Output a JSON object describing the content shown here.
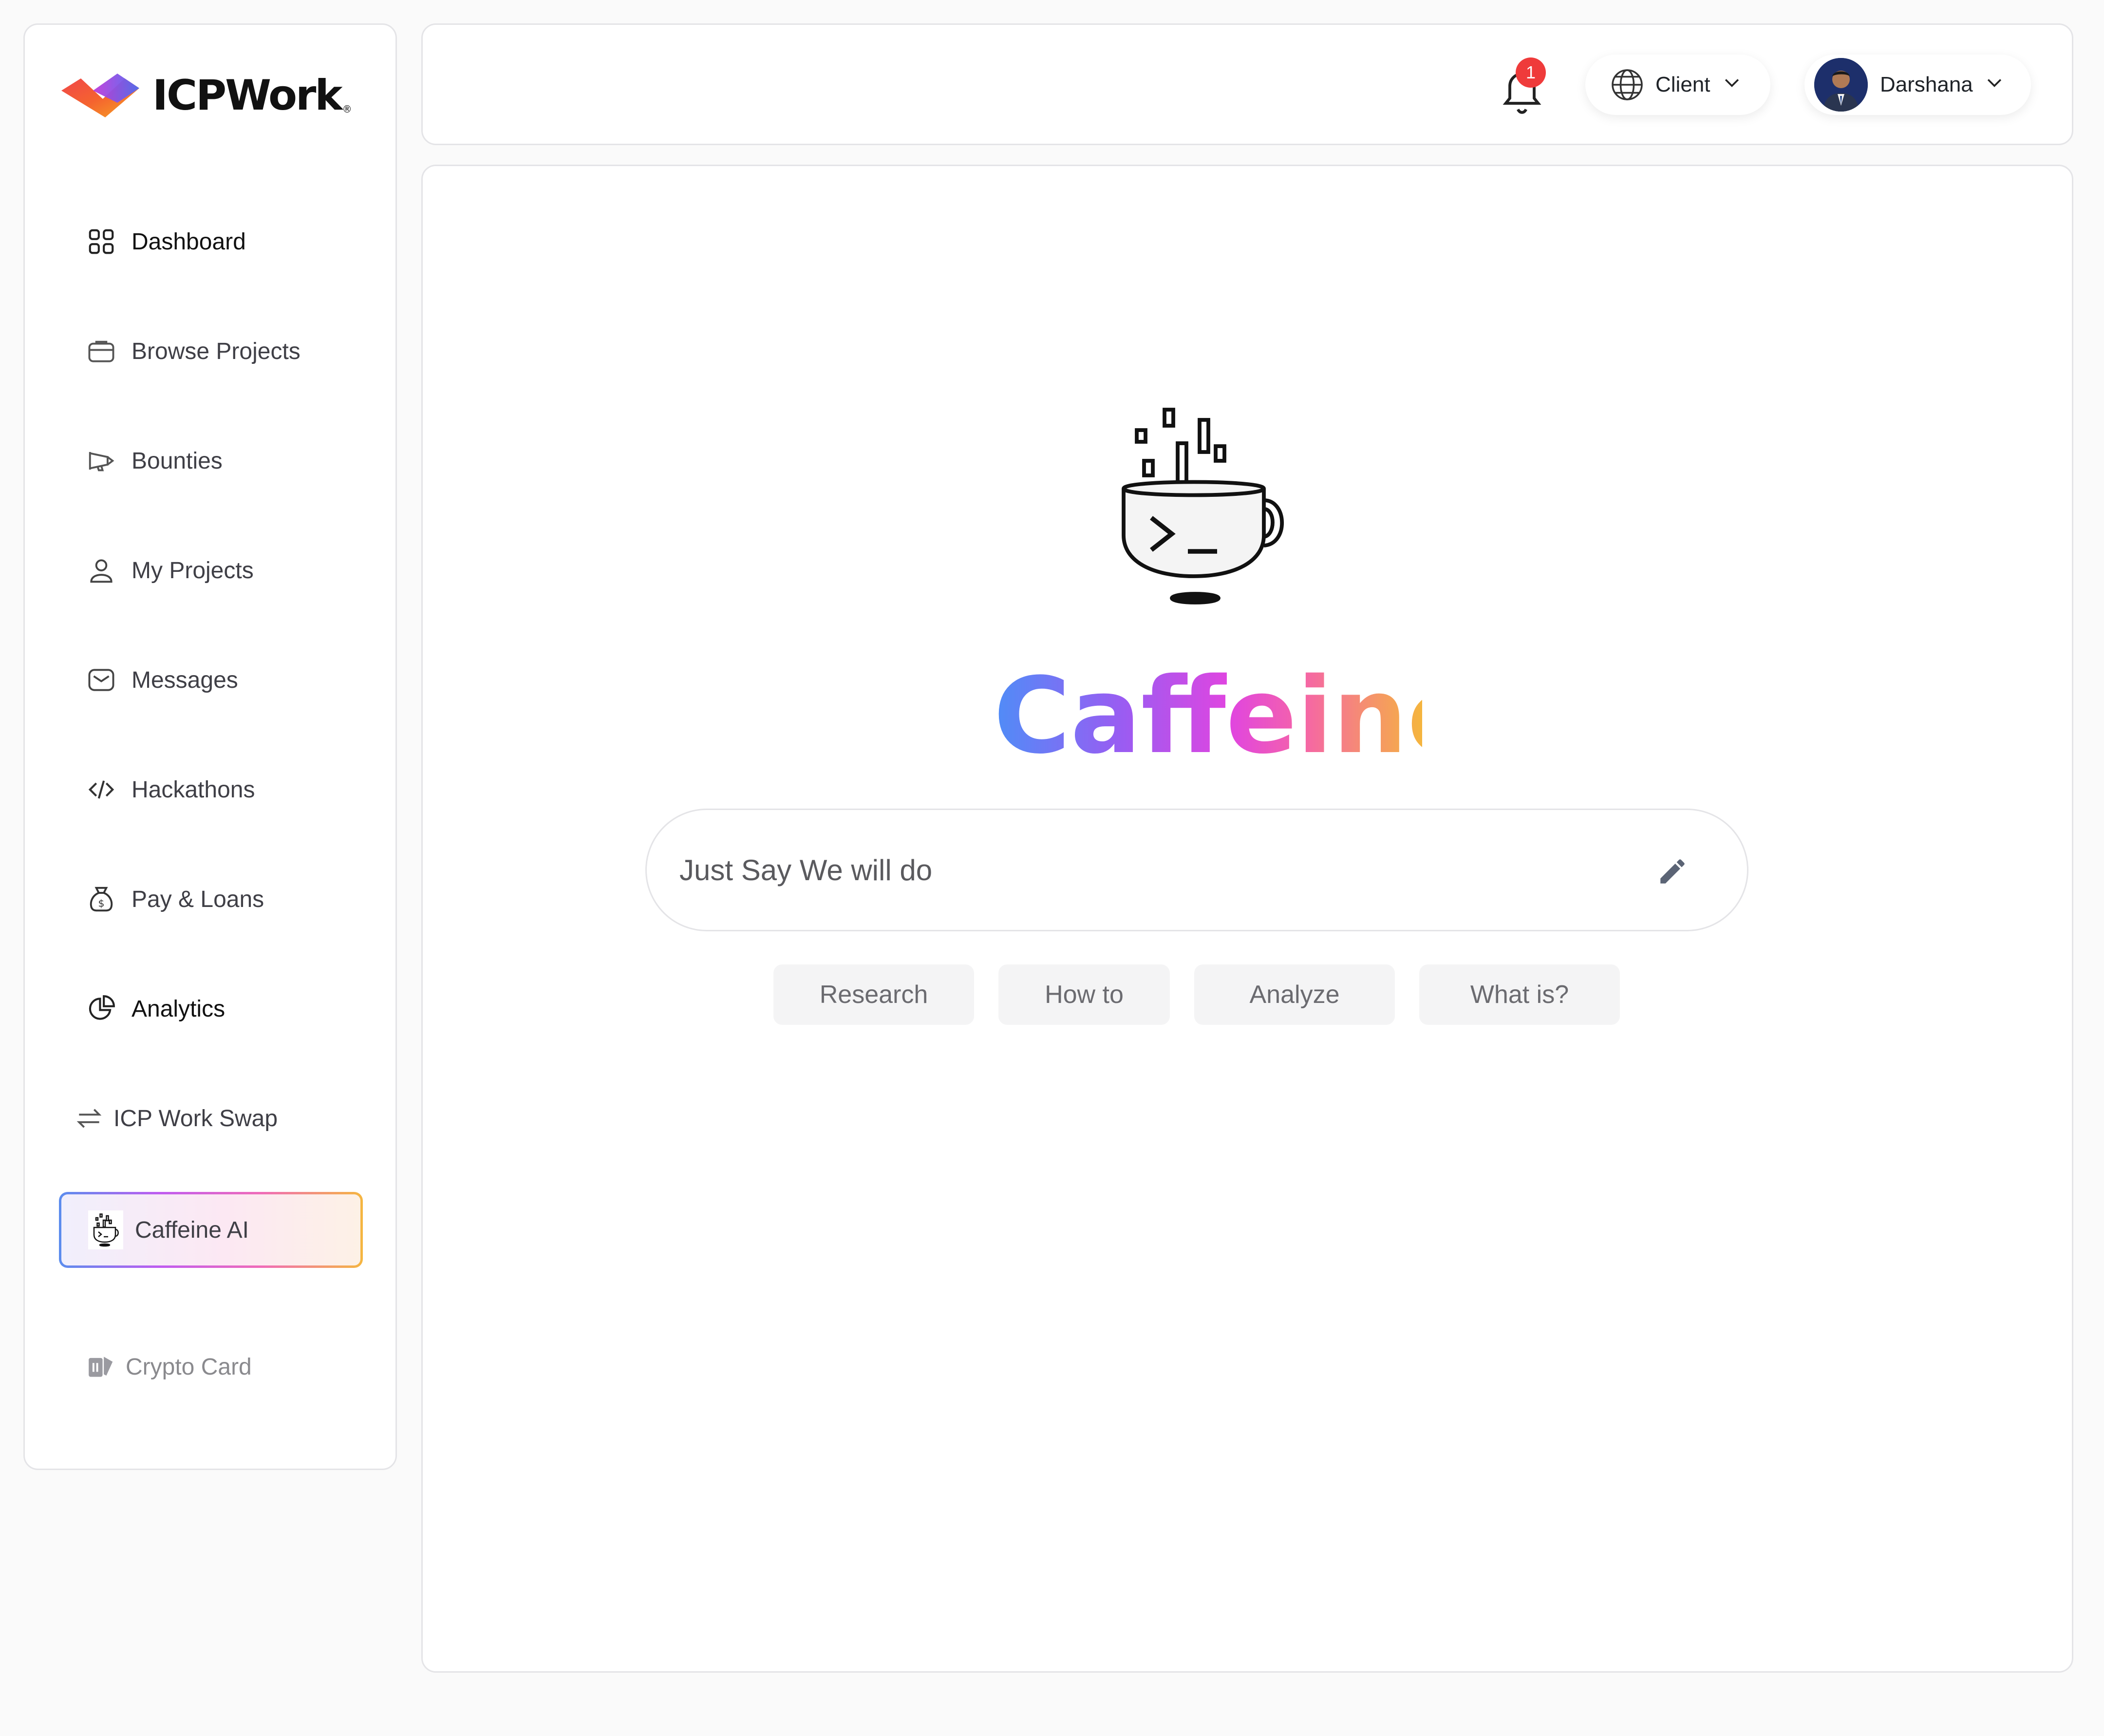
{
  "brand": {
    "logo_text": "ICPWork",
    "logo_mark": "®"
  },
  "sidebar": {
    "items": [
      {
        "label": "Dashboard",
        "icon": "grid-icon"
      },
      {
        "label": "Browse Projects",
        "icon": "briefcase-icon"
      },
      {
        "label": "Bounties",
        "icon": "megaphone-icon"
      },
      {
        "label": "My Projects",
        "icon": "user-icon"
      },
      {
        "label": "Messages",
        "icon": "mail-icon"
      },
      {
        "label": "Hackathons",
        "icon": "code-icon"
      },
      {
        "label": "Pay & Loans",
        "icon": "money-bag-icon"
      },
      {
        "label": "Analytics",
        "icon": "pie-chart-icon"
      },
      {
        "label": "ICP Work Swap",
        "icon": "swap-icon"
      },
      {
        "label": "Caffeine AI",
        "icon": "coffee-cup-icon",
        "active": true
      },
      {
        "label": "Crypto Card",
        "icon": "card-icon"
      }
    ]
  },
  "header": {
    "notifications_count": "1",
    "role": "Client",
    "user_name": "Darshana"
  },
  "main": {
    "title": "Caffeine",
    "search_placeholder": "Just Say We will do",
    "chips": [
      "Research",
      "How to",
      "Analyze",
      "What is?"
    ]
  },
  "colors": {
    "accent_gradient": [
      "#4f8df7",
      "#9a5cf2",
      "#e045e0",
      "#f564a8",
      "#f5b53e"
    ],
    "badge": "#ef3b3b"
  }
}
